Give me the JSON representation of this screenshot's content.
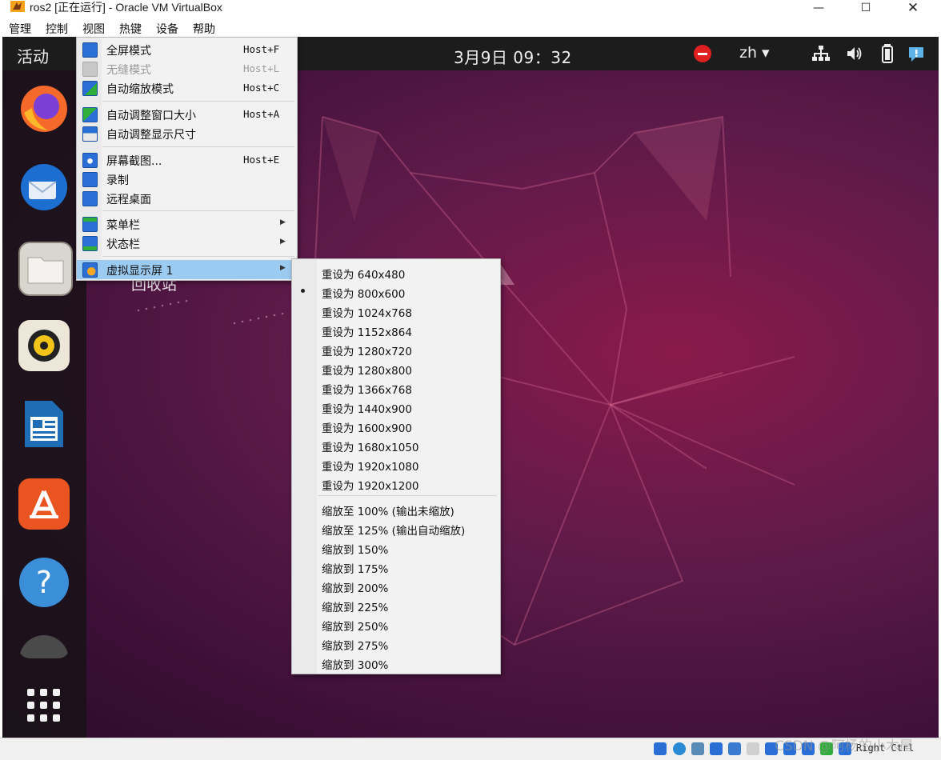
{
  "window": {
    "title": "ros2 [正在运行] - Oracle VM VirtualBox",
    "controls": [
      "minimize-icon",
      "maximize-icon",
      "close-icon"
    ]
  },
  "menubar": {
    "items": [
      "管理",
      "控制",
      "视图",
      "热键",
      "设备",
      "帮助"
    ]
  },
  "guest": {
    "activities": "活动",
    "clock": "3月9日  09：32",
    "lang": "zh",
    "desktop_label": "回收站",
    "dock_icons": [
      "firefox-icon",
      "thunderbird-icon",
      "files-icon",
      "rhythmbox-icon",
      "libreoffice-writer-icon",
      "software-center-icon",
      "help-icon",
      "dock-partial-icon",
      "show-apps-icon"
    ],
    "tray_icons": [
      "do-not-disturb-icon",
      "network-icon",
      "volume-icon",
      "battery-icon",
      "notification-icon"
    ]
  },
  "view_menu": {
    "items": [
      {
        "label": "全屏模式",
        "shortcut": "Host+F",
        "disabled": false,
        "icon": "fullscreen-icon"
      },
      {
        "label": "无缝模式",
        "shortcut": "Host+L",
        "disabled": true,
        "icon": "seamless-icon"
      },
      {
        "label": "自动缩放模式",
        "shortcut": "Host+C",
        "disabled": false,
        "icon": "scale-icon"
      },
      {
        "label": "自动调整窗口大小",
        "shortcut": "Host+A",
        "disabled": false,
        "icon": "adjust-window-icon"
      },
      {
        "label": "自动调整显示尺寸",
        "shortcut": "",
        "disabled": false,
        "icon": "auto-resize-icon"
      },
      {
        "label": "屏幕截图...",
        "shortcut": "Host+E",
        "disabled": false,
        "icon": "screenshot-icon"
      },
      {
        "label": "录制",
        "shortcut": "",
        "disabled": false,
        "icon": "record-icon"
      },
      {
        "label": "远程桌面",
        "shortcut": "",
        "disabled": false,
        "icon": "remote-desktop-icon"
      },
      {
        "label": "菜单栏",
        "shortcut": "",
        "disabled": false,
        "icon": "menubar-icon",
        "submenu": true
      },
      {
        "label": "状态栏",
        "shortcut": "",
        "disabled": false,
        "icon": "statusbar-icon",
        "submenu": true
      },
      {
        "label": "虚拟显示屏 1",
        "shortcut": "",
        "disabled": false,
        "icon": "virtual-screen-icon",
        "submenu": true,
        "selected": true
      }
    ]
  },
  "screen_submenu": {
    "resize_items": [
      "重设为 640x480",
      "重设为 800x600",
      "重设为 1024x768",
      "重设为 1152x864",
      "重设为 1280x720",
      "重设为 1280x800",
      "重设为 1366x768",
      "重设为 1440x900",
      "重设为 1600x900",
      "重设为 1680x1050",
      "重设为 1920x1080",
      "重设为 1920x1200"
    ],
    "checked_item": "重设为 800x600",
    "scale_items": [
      "缩放至 100% (输出未缩放)",
      "缩放至 125% (输出自动缩放)",
      "缩放到 150%",
      "缩放到 175%",
      "缩放到 200%",
      "缩放到 225%",
      "缩放到 250%",
      "缩放到 275%",
      "缩放到 300%"
    ]
  },
  "statusbar": {
    "host_key": "Right Ctrl",
    "watermark": "CSDN @阿杨的小木屋"
  }
}
